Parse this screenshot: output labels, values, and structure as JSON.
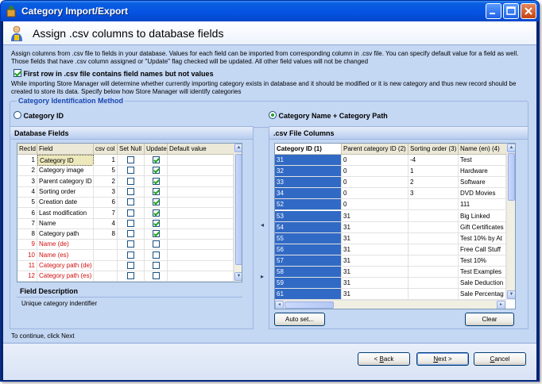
{
  "window": {
    "title": "Category Import/Export"
  },
  "header": {
    "title": "Assign .csv columns to database fields"
  },
  "intro": {
    "line1": "Assign columns from .csv file to fields in your database. Values for each field can be imported from corresponding column in .csv file. You can specify default value for a field as well.",
    "line2": "Those fields that have .csv column assigned or \"Update\" flag checked will be updated. All other field values will not be changed"
  },
  "first_row_check": {
    "label": "First row in .csv file contains field names but not values",
    "checked": true
  },
  "info": {
    "line1": "While importing Store Manager will determine whether currently importing category exists in database and it should be modified or it is new category and thus new record should be",
    "line2": "created to store its data. Specify below how Store Manager will identify categories"
  },
  "identification": {
    "legend": "Category Identification Method",
    "option_id": "Category ID",
    "option_name_path": "Category Name + Category Path",
    "selected": "option_name_path"
  },
  "db_fields": {
    "title": "Database Fields",
    "columns": [
      "RecId",
      "Field",
      "csv col",
      "Set Null",
      "Update",
      "Default value"
    ],
    "rows": [
      {
        "recid": "1",
        "field": "Category ID",
        "csv": "1",
        "setnull": false,
        "update": true,
        "red": false,
        "selected": true
      },
      {
        "recid": "2",
        "field": "Category image",
        "csv": "5",
        "setnull": false,
        "update": true,
        "red": false,
        "selected": false
      },
      {
        "recid": "3",
        "field": "Parent category ID",
        "csv": "2",
        "setnull": false,
        "update": true,
        "red": false,
        "selected": false
      },
      {
        "recid": "4",
        "field": "Sorting order",
        "csv": "3",
        "setnull": false,
        "update": true,
        "red": false,
        "selected": false
      },
      {
        "recid": "5",
        "field": "Creation date",
        "csv": "6",
        "setnull": false,
        "update": true,
        "red": false,
        "selected": false
      },
      {
        "recid": "6",
        "field": "Last modification",
        "csv": "7",
        "setnull": false,
        "update": true,
        "red": false,
        "selected": false
      },
      {
        "recid": "7",
        "field": "Name",
        "csv": "4",
        "setnull": false,
        "update": true,
        "red": false,
        "selected": false
      },
      {
        "recid": "8",
        "field": "Category path",
        "csv": "8",
        "setnull": false,
        "update": true,
        "red": false,
        "selected": false
      },
      {
        "recid": "9",
        "field": "Name (de)",
        "csv": "",
        "setnull": false,
        "update": false,
        "red": true,
        "selected": false
      },
      {
        "recid": "10",
        "field": "Name (es)",
        "csv": "",
        "setnull": false,
        "update": false,
        "red": true,
        "selected": false
      },
      {
        "recid": "11",
        "field": "Category path (de)",
        "csv": "",
        "setnull": false,
        "update": false,
        "red": true,
        "selected": false
      },
      {
        "recid": "12",
        "field": "Category path (es)",
        "csv": "",
        "setnull": false,
        "update": false,
        "red": true,
        "selected": false
      }
    ]
  },
  "field_description": {
    "label": "Field Description",
    "text": "Unique category indentifier"
  },
  "csv_columns": {
    "title": ".csv File Columns",
    "columns": [
      "Category ID (1)",
      "Parent category ID (2)",
      "Sorting order (3)",
      "Name (en) (4)"
    ],
    "rows": [
      [
        "31",
        "0",
        "-4",
        "Test"
      ],
      [
        "32",
        "0",
        "1",
        "Hardware"
      ],
      [
        "33",
        "0",
        "2",
        "Software"
      ],
      [
        "34",
        "0",
        "3",
        "DVD Movies"
      ],
      [
        "52",
        "0",
        "",
        "111"
      ],
      [
        "53",
        "31",
        "",
        "Big Linked"
      ],
      [
        "54",
        "31",
        "",
        "Gift Certificates"
      ],
      [
        "55",
        "31",
        "",
        "Test 10% by At"
      ],
      [
        "56",
        "31",
        "",
        "Free Call Stuff"
      ],
      [
        "57",
        "31",
        "",
        "Test 10%"
      ],
      [
        "58",
        "31",
        "",
        "Test Examples"
      ],
      [
        "59",
        "31",
        "",
        "Sale Deduction"
      ],
      [
        "61",
        "31",
        "",
        "Sale Percentag"
      ]
    ]
  },
  "buttons": {
    "auto_set": "Auto set...",
    "clear": "Clear",
    "back": "Back",
    "next": "Next >",
    "cancel": "Cancel"
  },
  "footer": {
    "hint": "To continue, click Next"
  }
}
